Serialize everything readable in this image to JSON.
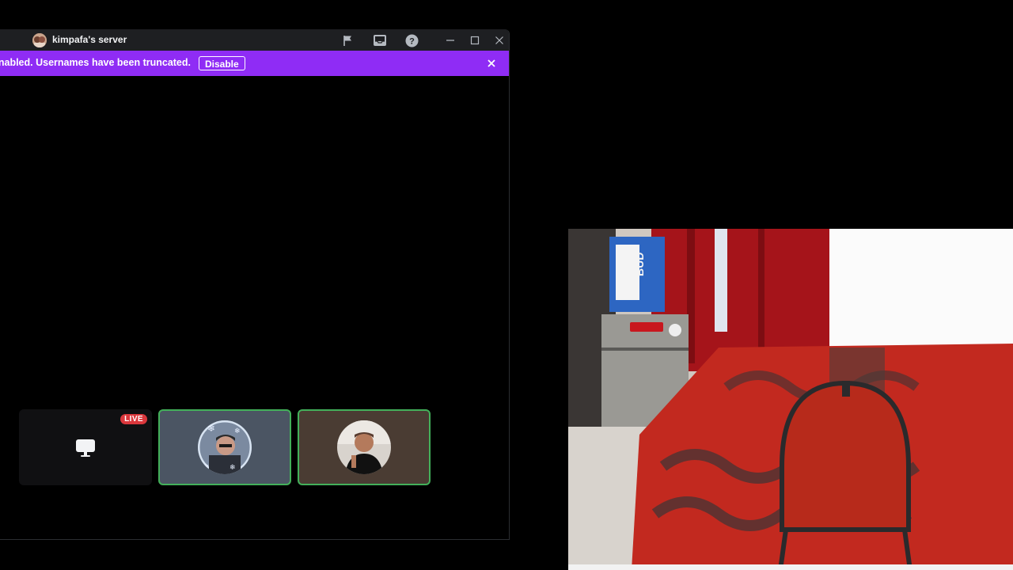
{
  "window": {
    "server_name": "kimpafa's server",
    "icons": [
      "flag-icon",
      "inbox-icon",
      "help-icon",
      "minimize-icon",
      "maximize-icon",
      "close-icon"
    ]
  },
  "notice": {
    "text": "le is enabled. Usernames have been truncated.",
    "button_label": "Disable",
    "color": "#8f2cf5"
  },
  "tiles": {
    "stream": {
      "badge": "LIVE",
      "icon": "monitor-icon"
    },
    "speaking_color": "#43b05a"
  },
  "colors": {
    "titlebar": "#1e1f22",
    "live": "#da373c"
  }
}
